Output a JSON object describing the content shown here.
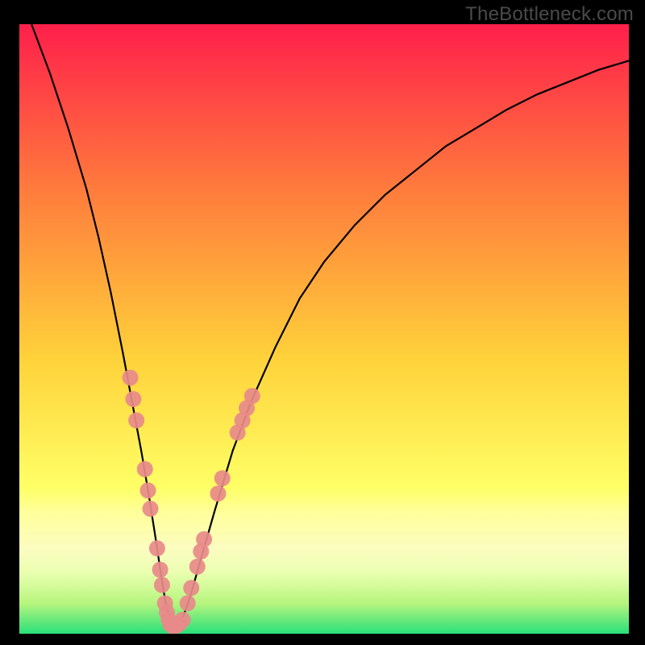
{
  "watermark": "TheBottleneck.com",
  "colors": {
    "frame": "#000000",
    "curve": "#000000",
    "marker_fill": "#e88a8a",
    "marker_stroke": "#e88a8a",
    "grad_top": "#ff1f4b",
    "grad_mid1": "#ff7e3c",
    "grad_mid2": "#ffd23a",
    "grad_band": "#ffff9a",
    "grad_bottom_band": "#fcfcc0",
    "grad_green1": "#b7f57e",
    "grad_green2": "#29e07a"
  },
  "chart_data": {
    "type": "line",
    "title": "",
    "xlabel": "",
    "ylabel": "",
    "xlim": [
      0,
      100
    ],
    "ylim": [
      0,
      100
    ],
    "series": [
      {
        "name": "bottleneck-curve",
        "x": [
          2,
          5,
          8,
          11,
          13,
          15,
          17,
          18.5,
          20,
          21.2,
          22.3,
          23.2,
          24,
          24.8,
          25.6,
          26.6,
          28,
          30,
          32,
          35,
          38,
          42,
          46,
          50,
          55,
          60,
          65,
          70,
          75,
          80,
          85,
          90,
          95,
          100
        ],
        "y": [
          100,
          92,
          83,
          73,
          65,
          56,
          46,
          38,
          30,
          23,
          16,
          10,
          5,
          2,
          1,
          2,
          6,
          13,
          20,
          30,
          38,
          47,
          55,
          61,
          67,
          72,
          76,
          80,
          83,
          86,
          88.5,
          90.5,
          92.5,
          94
        ]
      }
    ],
    "markers": [
      {
        "x": 18.2,
        "y": 42
      },
      {
        "x": 18.7,
        "y": 38.5
      },
      {
        "x": 19.2,
        "y": 35
      },
      {
        "x": 20.6,
        "y": 27
      },
      {
        "x": 21.1,
        "y": 23.5
      },
      {
        "x": 21.5,
        "y": 20.5
      },
      {
        "x": 22.6,
        "y": 14
      },
      {
        "x": 23.1,
        "y": 10.5
      },
      {
        "x": 23.4,
        "y": 8
      },
      {
        "x": 23.9,
        "y": 5
      },
      {
        "x": 24.2,
        "y": 3.5
      },
      {
        "x": 24.5,
        "y": 2.3
      },
      {
        "x": 24.8,
        "y": 1.5
      },
      {
        "x": 25.2,
        "y": 1.2
      },
      {
        "x": 25.7,
        "y": 1.3
      },
      {
        "x": 26.2,
        "y": 1.6
      },
      {
        "x": 26.8,
        "y": 2.3
      },
      {
        "x": 27.6,
        "y": 5
      },
      {
        "x": 28.2,
        "y": 7.5
      },
      {
        "x": 29.2,
        "y": 11
      },
      {
        "x": 29.8,
        "y": 13.5
      },
      {
        "x": 30.3,
        "y": 15.5
      },
      {
        "x": 32.6,
        "y": 23
      },
      {
        "x": 33.3,
        "y": 25.5
      },
      {
        "x": 35.8,
        "y": 33
      },
      {
        "x": 36.6,
        "y": 35
      },
      {
        "x": 37.3,
        "y": 37
      },
      {
        "x": 38.2,
        "y": 39
      }
    ],
    "marker_radius": 10
  }
}
